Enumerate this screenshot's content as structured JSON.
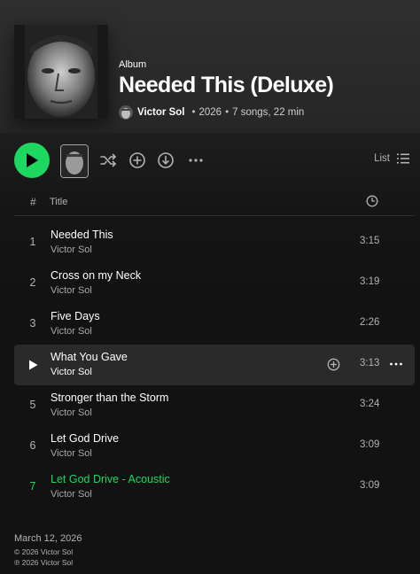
{
  "album": {
    "type_label": "Album",
    "title": "Needed This (Deluxe)",
    "artist": "Victor Sol",
    "year": "2026",
    "songs_summary": "7 songs, 22 min"
  },
  "controls": {
    "view_label": "List",
    "icons": [
      "play-icon",
      "shuffle-icon",
      "add-circle-icon",
      "download-icon",
      "more-icon",
      "list-icon"
    ]
  },
  "columns": {
    "number": "#",
    "title": "Title"
  },
  "tracks": [
    {
      "number": "1",
      "title": "Needed This",
      "artist": "Victor Sol",
      "duration": "3:15"
    },
    {
      "number": "2",
      "title": "Cross on my Neck",
      "artist": "Victor Sol",
      "duration": "3:19"
    },
    {
      "number": "3",
      "title": "Five Days",
      "artist": "Victor Sol",
      "duration": "2:26"
    },
    {
      "number": "4",
      "title": "What You Gave",
      "artist": "Victor Sol",
      "duration": "3:13"
    },
    {
      "number": "5",
      "title": "Stronger than the Storm",
      "artist": "Victor Sol",
      "duration": "3:24"
    },
    {
      "number": "6",
      "title": "Let God Drive",
      "artist": "Victor Sol",
      "duration": "3:09"
    },
    {
      "number": "7",
      "title": "Let God Drive - Acoustic",
      "artist": "Victor Sol",
      "duration": "3:09"
    }
  ],
  "footer": {
    "release_date": "March 12, 2026",
    "copyright": "© 2026 Victor Sol",
    "phonogram": "℗ 2026 Victor Sol"
  },
  "colors": {
    "accent": "#1ed760",
    "background": "#121212",
    "hover_row": "#2a2a2a"
  }
}
